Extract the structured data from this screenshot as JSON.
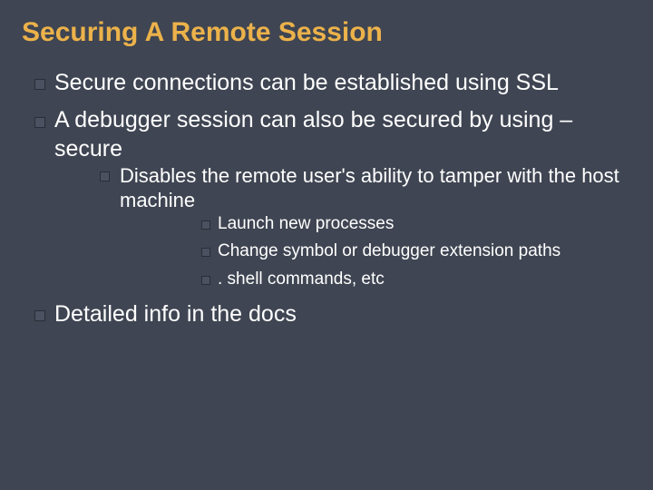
{
  "title": "Securing A Remote Session",
  "bullets": {
    "b1": "Secure connections can be established using SSL",
    "b2": "A debugger session can also be secured by using –secure",
    "b2_1": "Disables the remote user's ability to tamper with the host machine",
    "b2_1_1": "Launch new processes",
    "b2_1_2": "Change symbol or debugger extension paths",
    "b2_1_3": ". shell commands, etc",
    "b3": "Detailed info in the docs"
  }
}
